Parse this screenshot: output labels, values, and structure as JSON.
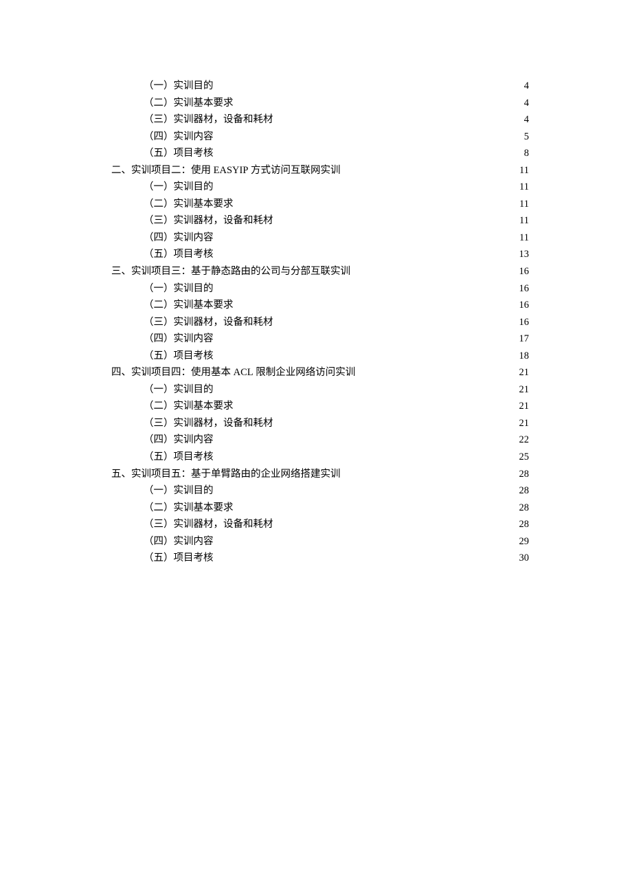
{
  "toc": [
    {
      "level": 2,
      "label": "（一）实训目的",
      "page": "4"
    },
    {
      "level": 2,
      "label": "（二）实训基本要求",
      "page": "4"
    },
    {
      "level": 2,
      "label": "（三）实训器材，设备和耗材",
      "page": "4"
    },
    {
      "level": 2,
      "label": "（四）实训内容",
      "page": "5"
    },
    {
      "level": 2,
      "label": "（五）项目考核",
      "page": "8"
    },
    {
      "level": 1,
      "label": "二、实训项目二：使用 EASYIP 方式访问互联网实训 ",
      "page": "11"
    },
    {
      "level": 2,
      "label": "（一）实训目的",
      "page": "11"
    },
    {
      "level": 2,
      "label": "（二）实训基本要求",
      "page": "11"
    },
    {
      "level": 2,
      "label": "（三）实训器材，设备和耗材",
      "page": "11"
    },
    {
      "level": 2,
      "label": "（四）实训内容",
      "page": "11"
    },
    {
      "level": 2,
      "label": "（五）项目考核",
      "page": "13"
    },
    {
      "level": 1,
      "label": "三、实训项目三：基于静态路由的公司与分部互联实训",
      "page": "16"
    },
    {
      "level": 2,
      "label": "（一）实训目的",
      "page": "16"
    },
    {
      "level": 2,
      "label": "（二）实训基本要求",
      "page": "16"
    },
    {
      "level": 2,
      "label": "（三）实训器材，设备和耗材",
      "page": "16"
    },
    {
      "level": 2,
      "label": "（四）实训内容",
      "page": "17"
    },
    {
      "level": 2,
      "label": "（五）项目考核",
      "page": "18"
    },
    {
      "level": 1,
      "label": "四、实训项目四：使用基本 ACL 限制企业网络访问实训",
      "page": "21"
    },
    {
      "level": 2,
      "label": "（一）实训目的",
      "page": "21"
    },
    {
      "level": 2,
      "label": "（二）实训基本要求",
      "page": "21"
    },
    {
      "level": 2,
      "label": "（三）实训器材，设备和耗材",
      "page": "21"
    },
    {
      "level": 2,
      "label": "（四）实训内容",
      "page": "22"
    },
    {
      "level": 2,
      "label": "（五）项目考核",
      "page": "25"
    },
    {
      "level": 1,
      "label": "五、实训项目五：基于单臂路由的企业网络搭建实训",
      "page": "28"
    },
    {
      "level": 2,
      "label": "（一）实训目的",
      "page": "28"
    },
    {
      "level": 2,
      "label": "（二）实训基本要求",
      "page": "28"
    },
    {
      "level": 2,
      "label": "（三）实训器材，设备和耗材",
      "page": "28"
    },
    {
      "level": 2,
      "label": "（四）实训内容",
      "page": "29"
    },
    {
      "level": 2,
      "label": "（五）项目考核",
      "page": "30"
    }
  ]
}
